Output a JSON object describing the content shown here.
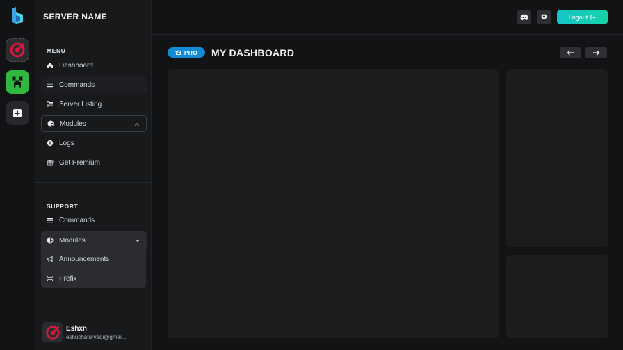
{
  "sidebar": {
    "server_name": "SERVER NAME",
    "menu_label": "MENU",
    "menu_items": [
      {
        "label": "Dashboard",
        "icon": "home-icon"
      },
      {
        "label": "Commands",
        "icon": "list-icon"
      },
      {
        "label": "Server Listing",
        "icon": "checklist-icon"
      },
      {
        "label": "Modules",
        "icon": "modules-icon"
      },
      {
        "label": "Logs",
        "icon": "info-icon"
      },
      {
        "label": "Get Premium",
        "icon": "gift-icon"
      }
    ],
    "support_label": "SUPPORT",
    "support_items": [
      {
        "label": "Commands",
        "icon": "list-icon"
      },
      {
        "label": "Modules",
        "icon": "modules-icon"
      },
      {
        "label": "Announcements",
        "icon": "megaphone-icon"
      },
      {
        "label": "Prefix",
        "icon": "command-key-icon"
      }
    ]
  },
  "user": {
    "name": "Eshxn",
    "email": "eshuchaturvedi@gmai..."
  },
  "header": {
    "logout_label": "Logout"
  },
  "main": {
    "badge": "PRO",
    "title": "MY DASHBOARD"
  },
  "colors": {
    "accent_start": "#17c4c7",
    "accent_end": "#16d3a6",
    "badge": "#1489d6",
    "server_red": "#d7193f",
    "server_green": "#2fb73f"
  }
}
